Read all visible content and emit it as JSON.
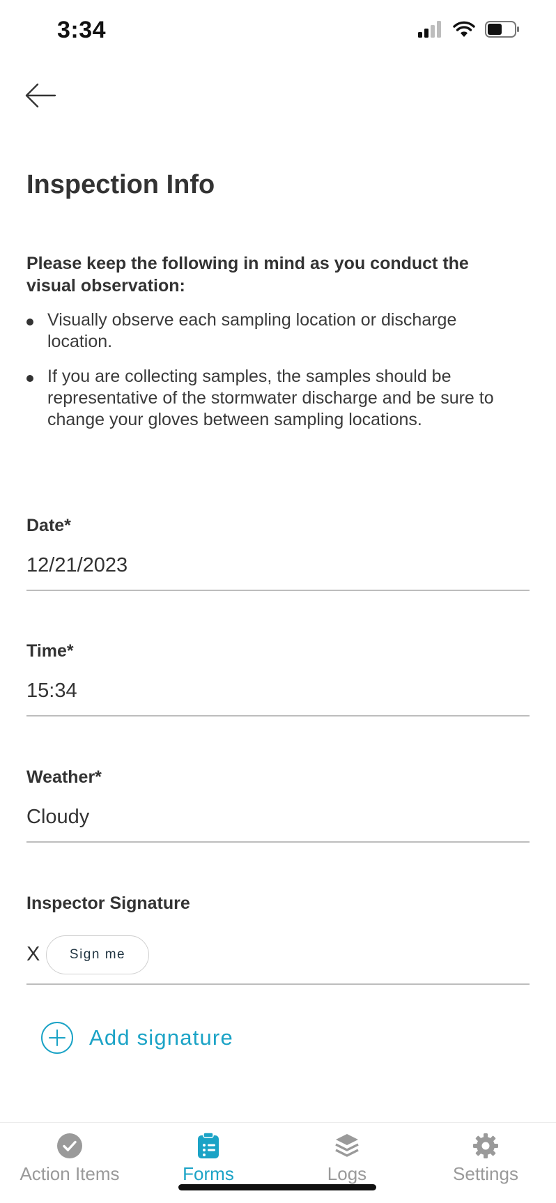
{
  "status_bar": {
    "time": "3:34"
  },
  "page": {
    "title": "Inspection Info"
  },
  "intro": {
    "heading": "Please keep the following in mind as you conduct the visual observation:",
    "bullets": [
      "Visually observe each sampling location or discharge location.",
      "If you are collecting samples, the samples should be representative of the stormwater discharge and be sure to change your gloves between sampling locations."
    ]
  },
  "fields": {
    "date": {
      "label": "Date*",
      "value": "12/21/2023"
    },
    "time": {
      "label": "Time*",
      "value": "15:34"
    },
    "weather": {
      "label": "Weather*",
      "value": "Cloudy"
    },
    "signature": {
      "label": "Inspector Signature",
      "x_mark": "X",
      "sign_button": "Sign me"
    }
  },
  "add_signature": {
    "label": "Add signature"
  },
  "tabs": [
    {
      "label": "Action Items",
      "icon": "check-circle-icon"
    },
    {
      "label": "Forms",
      "icon": "clipboard-icon",
      "active": true
    },
    {
      "label": "Logs",
      "icon": "layers-icon"
    },
    {
      "label": "Settings",
      "icon": "gear-icon"
    }
  ],
  "colors": {
    "accent": "#1ba3c6",
    "inactive": "#9a9a9a",
    "text": "#333333",
    "divider": "#bdbdbd"
  }
}
